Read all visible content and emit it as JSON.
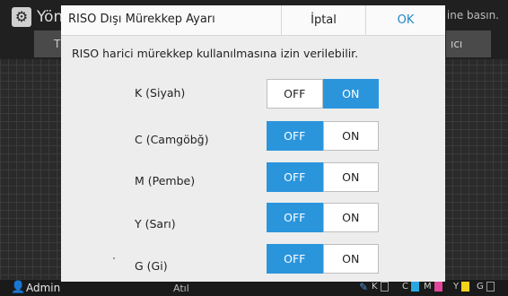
{
  "background": {
    "title": "Yön",
    "hint": "ine basın.",
    "tab_left_label": "T",
    "tab_right_label": "ıcı",
    "user_label": "Admin",
    "bottom_center_label": "Atıl",
    "ink_levels": [
      {
        "label": "K",
        "color": "#222222"
      },
      {
        "label": "C",
        "color": "#29a8e0"
      },
      {
        "label": "M",
        "color": "#e0479a"
      },
      {
        "label": "Y",
        "color": "#f2d21b"
      },
      {
        "label": "G",
        "color": "#9a9a9a"
      }
    ]
  },
  "dialog": {
    "title": "RISO Dışı Mürekkep Ayarı",
    "cancel_label": "İptal",
    "ok_label": "OK",
    "description": "RISO harici mürekkep kullanılmasına izin verilebilir.",
    "rows": [
      {
        "label": "K (Siyah)",
        "off_label": "OFF",
        "on_label": "ON",
        "selected": "ON"
      },
      {
        "label": "C (Camgöbğ)",
        "off_label": "OFF",
        "on_label": "ON",
        "selected": "OFF"
      },
      {
        "label": "M (Pembe)",
        "off_label": "OFF",
        "on_label": "ON",
        "selected": "OFF"
      },
      {
        "label": "Y (Sarı)",
        "off_label": "OFF",
        "on_label": "ON",
        "selected": "OFF"
      },
      {
        "label": "G (Gi)",
        "off_label": "OFF",
        "on_label": "ON",
        "selected": "OFF"
      }
    ]
  },
  "colors": {
    "accent": "#2b95dc",
    "ok_text": "#1e88c8"
  }
}
